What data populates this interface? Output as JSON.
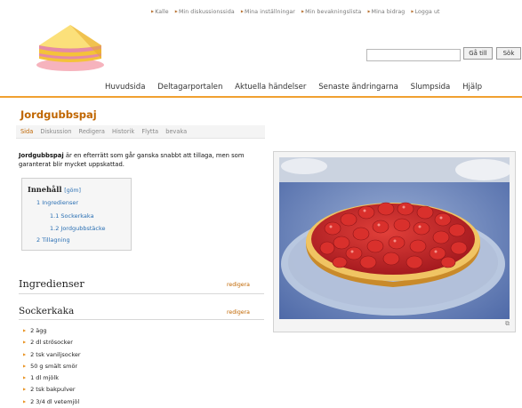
{
  "personal_links": [
    "Kalle",
    "Min diskussionssida",
    "Mina inställningar",
    "Min bevakningslista",
    "Mina bidrag",
    "Logga ut"
  ],
  "search": {
    "go_label": "Gå till",
    "search_label": "Sök",
    "value": ""
  },
  "nav": [
    "Huvudsida",
    "Deltagarportalen",
    "Aktuella händelser",
    "Senaste ändringarna",
    "Slumpsida",
    "Hjälp"
  ],
  "page": {
    "title": "Jordgubbspaj",
    "tabs": [
      "Sida",
      "Diskussion",
      "Redigera",
      "Historik",
      "Flytta",
      "bevaka"
    ],
    "intro_bold": "Jordgubbspaj",
    "intro_rest": " är en efterrätt som går ganska snabbt att tillaga, men som garanterat blir mycket uppskattad."
  },
  "toc": {
    "title": "Innehåll",
    "hide": "göm",
    "items": [
      "1 Ingredienser",
      "1.1 Sockerkaka",
      "1.2 Jordgubbstäcke",
      "2 Tillagning"
    ]
  },
  "sections": {
    "ingredienser": "Ingredienser",
    "sockerkaka": "Sockerkaka",
    "edit_label": "redigera"
  },
  "ingredients": [
    "2 ägg",
    "2 dl strösocker",
    "2 tsk vaniljsocker",
    "50 g smält smör",
    "1 dl mjölk",
    "2 tsk bakpulver",
    "2 3/4 dl vetemjöl"
  ],
  "colors": {
    "accent": "#c06600",
    "nav_line": "#f0a030",
    "link": "#2a6fb3"
  }
}
